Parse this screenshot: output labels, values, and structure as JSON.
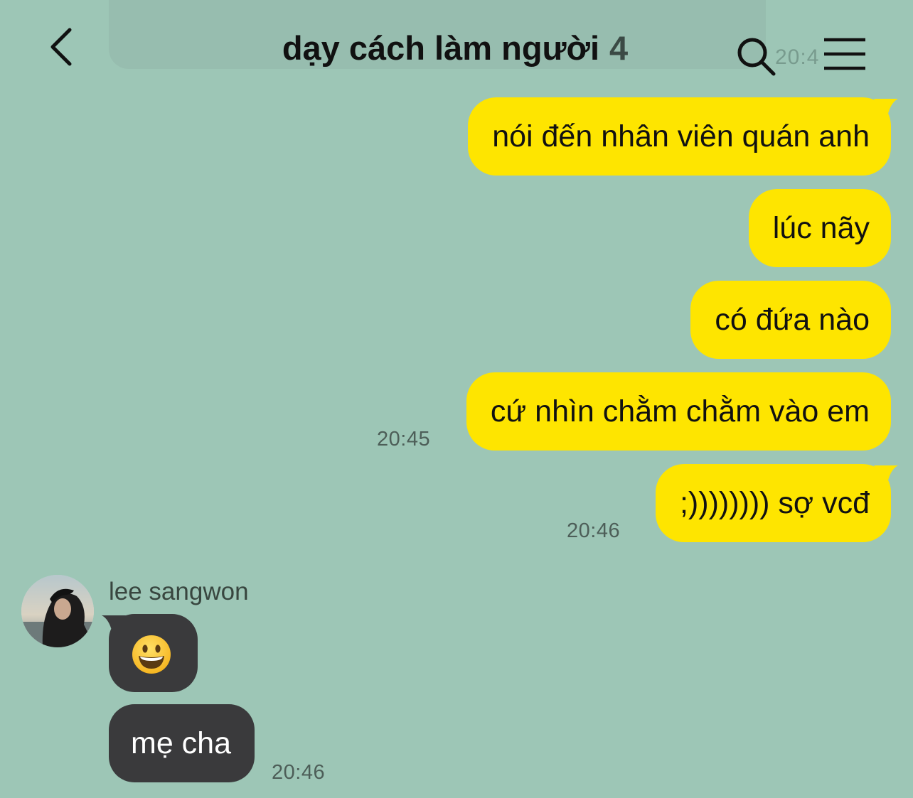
{
  "header": {
    "title": "dạy cách làm người",
    "member_count": "4",
    "back_icon": "chevron-left-icon",
    "search_icon": "search-icon",
    "menu_icon": "hamburger-menu-icon"
  },
  "previous_message_time": "20:4",
  "outgoing_messages": [
    {
      "text": "nói đến nhân viên quán anh"
    },
    {
      "text": "lúc nãy"
    },
    {
      "text": "có đứa nào"
    },
    {
      "text": "cứ nhìn chằm chằm vào em",
      "time": "20:45"
    },
    {
      "text": ";)))))))) sợ vcđ",
      "time": "20:46"
    }
  ],
  "incoming": {
    "sender_name": "lee sangwon",
    "messages": [
      {
        "emoji": "grinning-face-emoji"
      },
      {
        "text": "mẹ cha",
        "time": "20:46"
      }
    ]
  },
  "colors": {
    "background": "#9dc6b6",
    "outgoing_bubble": "#fee500",
    "incoming_bubble": "#3a3a3c"
  }
}
